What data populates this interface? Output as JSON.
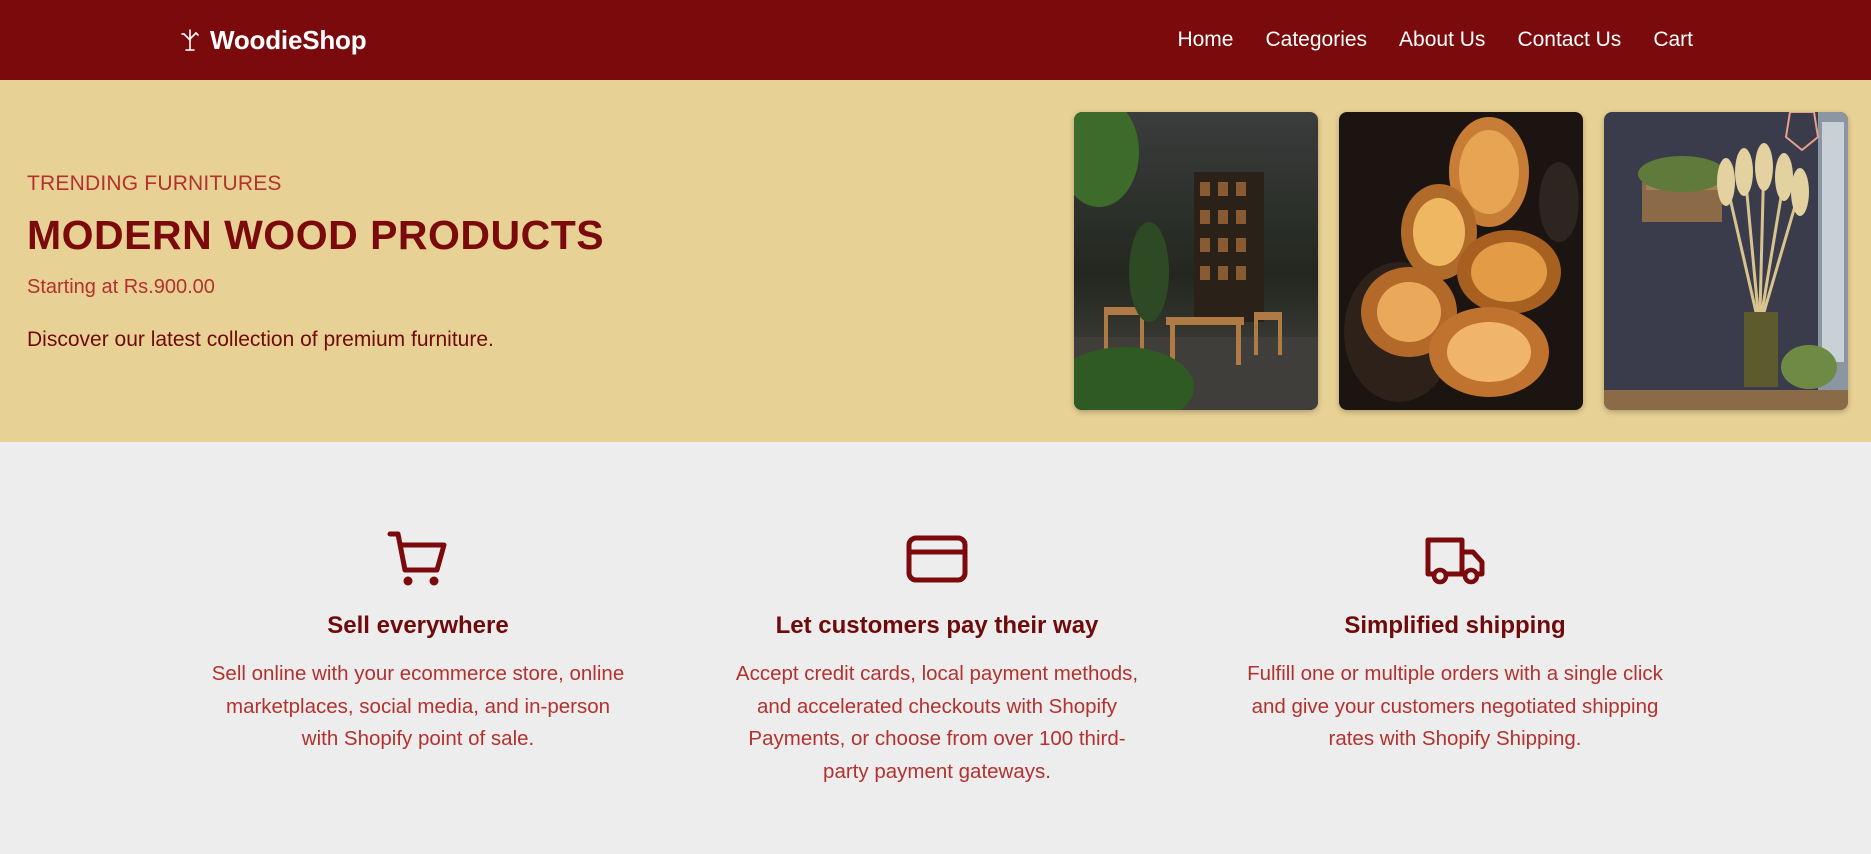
{
  "brand": {
    "name": "WoodieShop",
    "icon": "tree-icon"
  },
  "nav": [
    {
      "label": "Home"
    },
    {
      "label": "Categories"
    },
    {
      "label": "About Us"
    },
    {
      "label": "Contact Us"
    },
    {
      "label": "Cart"
    }
  ],
  "hero": {
    "eyebrow": "TRENDING FURNITURES",
    "title": "MODERN WOOD PRODUCTS",
    "price": "Starting at Rs.900.00",
    "description": "Discover our latest collection of premium furniture."
  },
  "features": [
    {
      "icon": "cart-icon",
      "title": "Sell everywhere",
      "text": "Sell online with your ecommerce store, online marketplaces, social media, and in-person with Shopify point of sale."
    },
    {
      "icon": "credit-card-icon",
      "title": "Let customers pay their way",
      "text": "Accept credit cards, local payment methods, and accelerated checkouts with Shopify Payments, or choose from over 100 third-party payment gateways."
    },
    {
      "icon": "truck-icon",
      "title": "Simplified shipping",
      "text": "Fulfill one or multiple orders with a single click and give your customers negotiated shipping rates with Shopify Shipping."
    }
  ],
  "colors": {
    "primary": "#7a0a0b",
    "hero_bg": "#e8d194",
    "accent_text": "#b2322f",
    "page_bg": "#ededed"
  }
}
